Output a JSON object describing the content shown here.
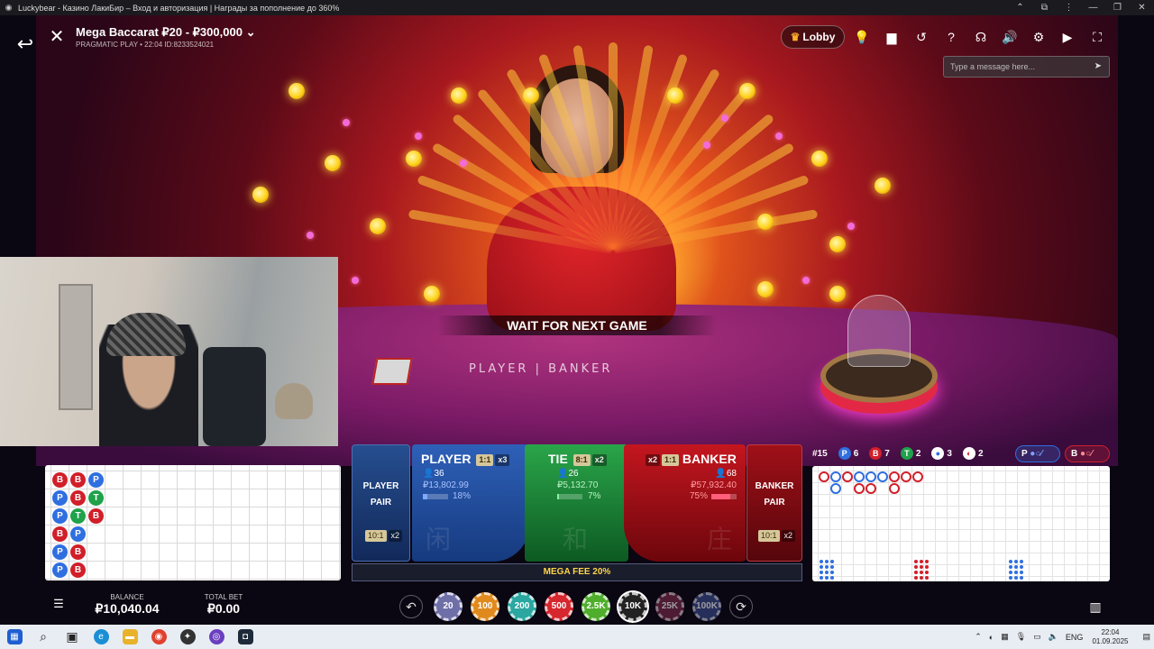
{
  "browser": {
    "tab_title": "Luckybear - Казино ЛакиБир – Вход и авторизация | Награды за пополнение до 360%"
  },
  "game": {
    "title": "Mega Baccarat ₽20 - ₽300,000",
    "subtitle": "PRAGMATIC PLAY • 22:04 ID:8233524021",
    "status_banner": "WAIT FOR NEXT GAME",
    "felt_text": "PLAYER | BANKER",
    "lobby_label": "Lobby",
    "chat_placeholder": "Type a message here..."
  },
  "toolbar_icons": [
    "lightbulb-icon",
    "chat-icon",
    "history-icon",
    "help-icon",
    "support-icon",
    "volume-icon",
    "settings-icon",
    "video-icon",
    "fullscreen-icon"
  ],
  "bet_spots": {
    "player_pair": {
      "name_line1": "PLAYER",
      "name_line2": "PAIR",
      "payout": "10:1",
      "mult": "x2"
    },
    "player": {
      "name": "PLAYER",
      "payout": "1:1",
      "mult": "x3",
      "players": "36",
      "amount": "₽13,802.99",
      "percent": "18%",
      "percent_value": 18,
      "watermark": "闲"
    },
    "tie": {
      "name": "TIE",
      "payout": "8:1",
      "mult": "x2",
      "players": "26",
      "amount": "₽5,132.70",
      "percent": "7%",
      "percent_value": 7,
      "watermark": "和"
    },
    "banker": {
      "name": "BANKER",
      "payout": "1:1",
      "mult": "x2",
      "players": "68",
      "amount": "₽57,932.40",
      "percent": "75%",
      "percent_value": 75,
      "watermark": "庄"
    },
    "banker_pair": {
      "name_line1": "BANKER",
      "name_line2": "PAIR",
      "payout": "10:1",
      "mult": "x2"
    }
  },
  "mega_fee": "MEGA FEE 20%",
  "stats": {
    "round": "#15",
    "player_count": "6",
    "banker_count": "7",
    "tie_count": "2",
    "player_pair_count": "3",
    "banker_pair_count": "2",
    "player_predict": "P",
    "banker_predict": "B"
  },
  "bead_road": {
    "columns": [
      [
        "B",
        "P",
        "P",
        "B",
        "P",
        "P"
      ],
      [
        "B",
        "B",
        "T",
        "P",
        "B",
        "B"
      ],
      [
        "P",
        "T",
        "B"
      ]
    ]
  },
  "wallet": {
    "balance_label": "BALANCE",
    "balance": "₽10,040.04",
    "total_bet_label": "TOTAL BET",
    "total_bet": "₽0.00"
  },
  "chips": [
    {
      "label": "20",
      "color": "#6f6fa8"
    },
    {
      "label": "100",
      "color": "#e08a1e"
    },
    {
      "label": "200",
      "color": "#2aa7a0"
    },
    {
      "label": "500",
      "color": "#d6262e"
    },
    {
      "label": "2.5K",
      "color": "#4fae2b"
    },
    {
      "label": "10K",
      "color": "#222222"
    },
    {
      "label": "25K",
      "color": "#7a2a4a"
    },
    {
      "label": "100K",
      "color": "#3a4a8a"
    }
  ],
  "colors": {
    "player": "#2f6fe0",
    "banker": "#d11f2a",
    "tie": "#1fa24a"
  },
  "taskbar": {
    "language": "ENG",
    "time": "22:04",
    "date": "01.09.2025"
  }
}
